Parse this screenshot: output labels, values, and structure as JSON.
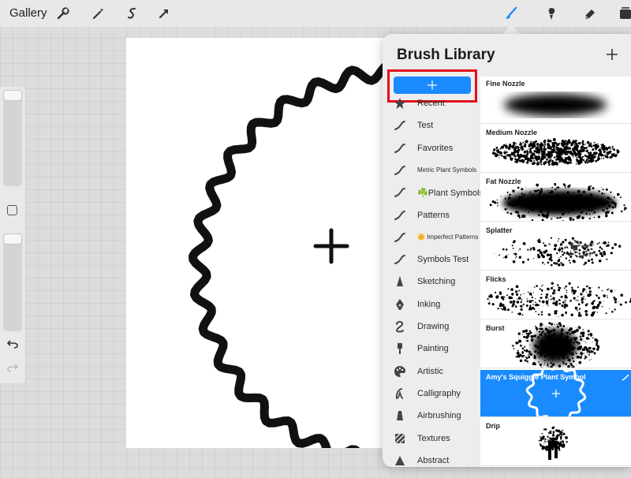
{
  "toolbar": {
    "gallery_label": "Gallery",
    "left_tools": [
      "wrench-icon",
      "magic-wand-icon",
      "selection-icon",
      "transform-arrow-icon"
    ],
    "right_tools": [
      "brush-icon",
      "smudge-icon",
      "eraser-icon",
      "layers-icon"
    ],
    "active_tool_color": "#1a8bff"
  },
  "panel": {
    "title": "Brush Library",
    "sets": [
      {
        "label": "Recent",
        "icon": "star-icon"
      },
      {
        "label": "Test",
        "icon": "stroke-icon"
      },
      {
        "label": "Favorites",
        "icon": "stroke-icon"
      },
      {
        "label": "Metric Plant Symbols",
        "icon": "stroke-icon"
      },
      {
        "label": "☘️Plant Symbols",
        "icon": "stroke-icon"
      },
      {
        "label": "Patterns",
        "icon": "stroke-icon"
      },
      {
        "label": "🌼 Imperfect Patterns",
        "icon": "stroke-icon"
      },
      {
        "label": "Symbols Test",
        "icon": "stroke-icon"
      },
      {
        "label": "Sketching",
        "icon": "pencil-tip-icon"
      },
      {
        "label": "Inking",
        "icon": "pen-nib-icon"
      },
      {
        "label": "Drawing",
        "icon": "squiggle-icon"
      },
      {
        "label": "Painting",
        "icon": "paintbrush-icon"
      },
      {
        "label": "Artistic",
        "icon": "palette-icon"
      },
      {
        "label": "Calligraphy",
        "icon": "calligraphy-icon"
      },
      {
        "label": "Airbrushing",
        "icon": "airbrush-icon"
      },
      {
        "label": "Textures",
        "icon": "texture-icon"
      },
      {
        "label": "Abstract",
        "icon": "triangle-icon"
      }
    ],
    "brushes": [
      {
        "name": "Fine Nozzle",
        "selected": false
      },
      {
        "name": "Medium Nozzle",
        "selected": false
      },
      {
        "name": "Fat Nozzle",
        "selected": false
      },
      {
        "name": "Splatter",
        "selected": false
      },
      {
        "name": "Flicks",
        "selected": false
      },
      {
        "name": "Burst",
        "selected": false
      },
      {
        "name": "Amy's Squiggle Plant Symbol",
        "selected": true
      },
      {
        "name": "Drip",
        "selected": false
      }
    ],
    "accent_color": "#1a8bff",
    "highlight_color": "#e0101a"
  }
}
